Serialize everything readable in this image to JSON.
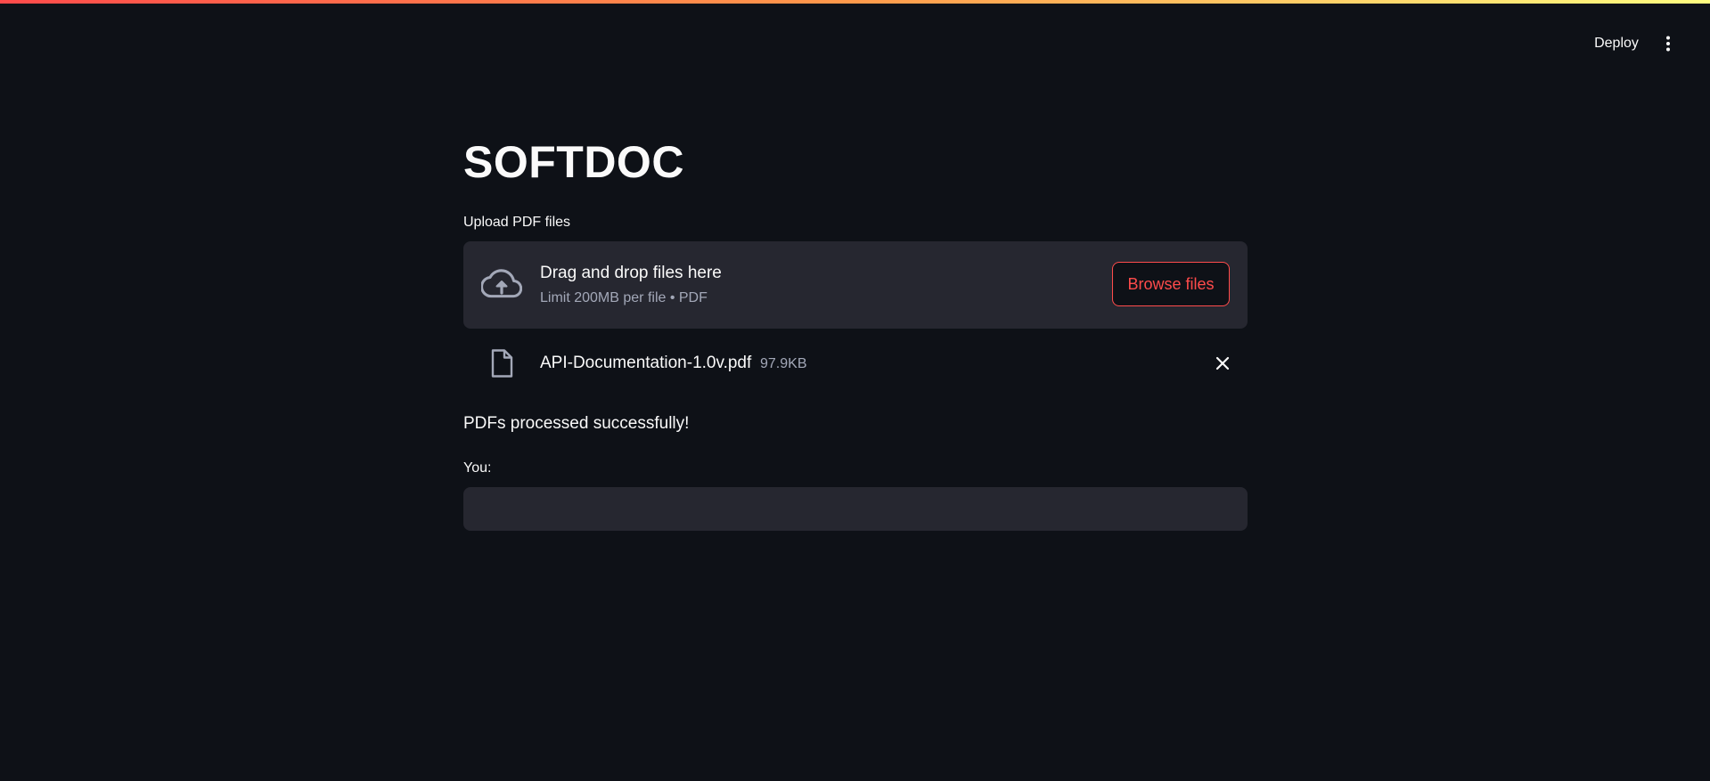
{
  "header": {
    "deploy_label": "Deploy",
    "menu_icon": "vertical-dots-icon"
  },
  "main": {
    "title": "SOFTDOC",
    "uploader": {
      "label": "Upload PDF files",
      "icon": "cloud-upload-icon",
      "drop_title": "Drag and drop files here",
      "limit_text": "Limit 200MB per file • PDF",
      "browse_label": "Browse files"
    },
    "uploaded_files": [
      {
        "icon": "file-icon",
        "name": "API-Documentation-1.0v.pdf",
        "size": "97.9KB",
        "remove_icon": "close-icon"
      }
    ],
    "status_message": "PDFs processed successfully!",
    "chat_input": {
      "label": "You:",
      "value": "",
      "placeholder": ""
    }
  },
  "colors": {
    "background": "#0e1117",
    "surface": "#262730",
    "accent": "#ff4b4b",
    "text": "#fafafa",
    "muted_text": "#a3a8b8"
  }
}
